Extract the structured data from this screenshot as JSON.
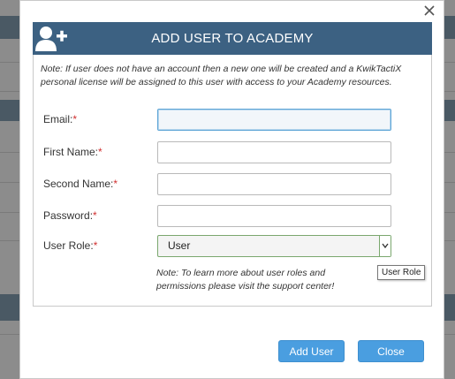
{
  "dialog": {
    "title": "ADD USER TO ACADEMY",
    "note": "Note: If user does not have an account then a new one will be created and a KwikTactiX personal license will be assigned to this user with access to your Academy resources.",
    "header_icon": "add-user-icon",
    "close_icon": "close-icon"
  },
  "form": {
    "email": {
      "label": "Email:",
      "required": "*",
      "value": ""
    },
    "first_name": {
      "label": "First Name:",
      "required": "*",
      "value": ""
    },
    "second_name": {
      "label": "Second Name:",
      "required": "*",
      "value": ""
    },
    "password": {
      "label": "Password:",
      "required": "*",
      "value": ""
    },
    "user_role": {
      "label": "User Role:",
      "required": "*",
      "selected": "User"
    }
  },
  "role_note": "Note: To learn more about user roles and permissions please visit the support center!",
  "tooltip": "User Role",
  "buttons": {
    "add_user": "Add User",
    "close": "Close"
  },
  "colors": {
    "header": "#3c6182",
    "button": "#4a9ee0",
    "required": "#d03030"
  }
}
